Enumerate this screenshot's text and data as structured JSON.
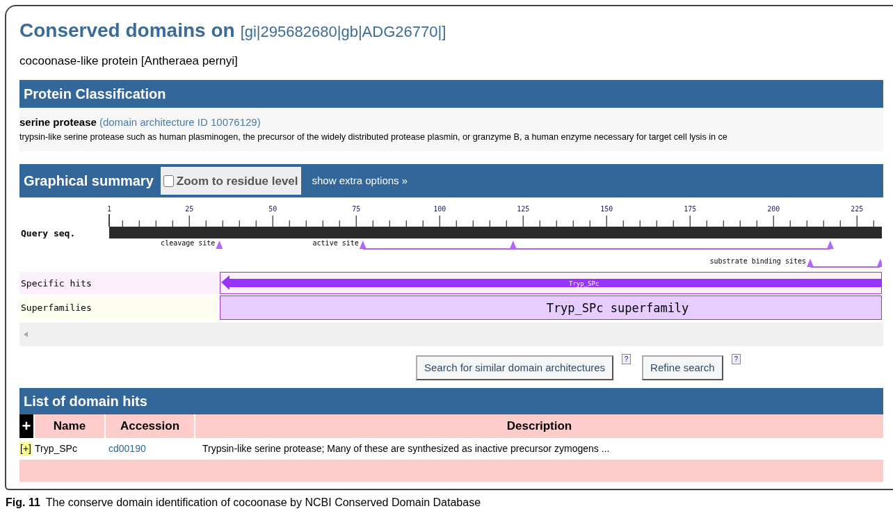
{
  "title": "Conserved domains on",
  "query_id": "[gi|295682680|gb|ADG26770|]",
  "protein_name": "cocoonase-like protein [Antheraea pernyi]",
  "classification": {
    "heading": "Protein Classification",
    "name": "serine protease",
    "architecture_link": "(domain architecture ID 10076129)",
    "description": "trypsin-like serine protease such as human plasminogen, the precursor of the widely distributed protease plasmin, or granzyme B, a human enzyme necessary for target cell lysis in ce"
  },
  "graphical_summary": {
    "heading": "Graphical summary",
    "zoom_checkbox": {
      "label": "Zoom to residue level",
      "checked": false
    },
    "extra_options_link": "show extra options »",
    "ruler_ticks": [
      "1",
      "25",
      "50",
      "75",
      "100",
      "125",
      "150",
      "175",
      "200",
      "225"
    ],
    "query_label": "Query seq.",
    "sites": [
      {
        "label": "cleavage site"
      },
      {
        "label": "active site"
      },
      {
        "label": "substrate binding sites"
      }
    ],
    "specific_hits": {
      "label": "Specific hits",
      "name": "Tryp_SPc"
    },
    "superfamilies": {
      "label": "Superfamilies",
      "name": "Tryp_SPc superfamily"
    }
  },
  "buttons": [
    {
      "label": "Search for similar domain architectures",
      "help": "?"
    },
    {
      "label": "Refine search",
      "help": "?"
    }
  ],
  "domain_hits": {
    "heading": "List of domain hits",
    "expand_all": "+",
    "columns": [
      "Name",
      "Accession",
      "Description"
    ],
    "rows": [
      {
        "expander": "[+]",
        "name": "Tryp_SPc",
        "accession": "cd00190",
        "description": "Trypsin-like serine protease; Many of these are synthesized as inactive precursor zymogens ..."
      }
    ]
  },
  "caption": {
    "label": "Fig. 11",
    "text": "The conserve domain identification of cocoonase by NCBI Conserved Domain Database"
  }
}
